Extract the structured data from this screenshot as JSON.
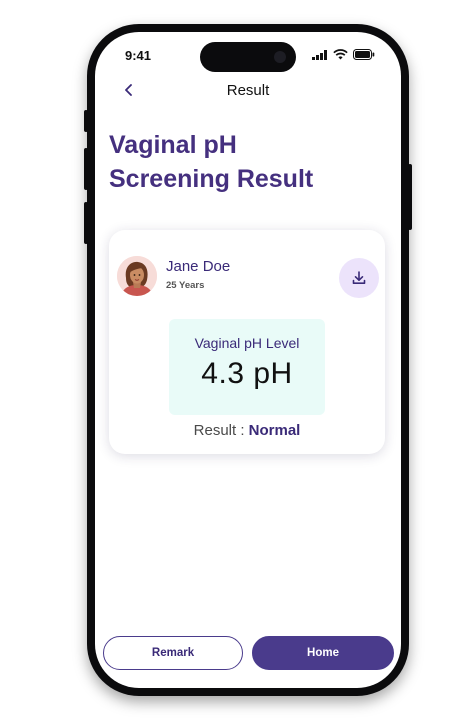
{
  "status_bar": {
    "time": "9:41"
  },
  "nav": {
    "title": "Result"
  },
  "heading": {
    "line1": "Vaginal pH",
    "line2": "Screening Result"
  },
  "patient": {
    "name": "Jane Doe",
    "age": "25 Years"
  },
  "measurement": {
    "label": "Vaginal pH Level",
    "value": "4.3 pH"
  },
  "result": {
    "prefix": "Result : ",
    "value": "Normal"
  },
  "buttons": {
    "remark": "Remark",
    "home": "Home"
  },
  "colors": {
    "brand": "#45307f",
    "button": "#4a3b8c",
    "download_bg": "#ece3fb",
    "value_box_bg": "#e9fbf8"
  },
  "icons": [
    "back-chevron-icon",
    "signal-icon",
    "wifi-icon",
    "battery-icon",
    "download-icon",
    "avatar"
  ]
}
